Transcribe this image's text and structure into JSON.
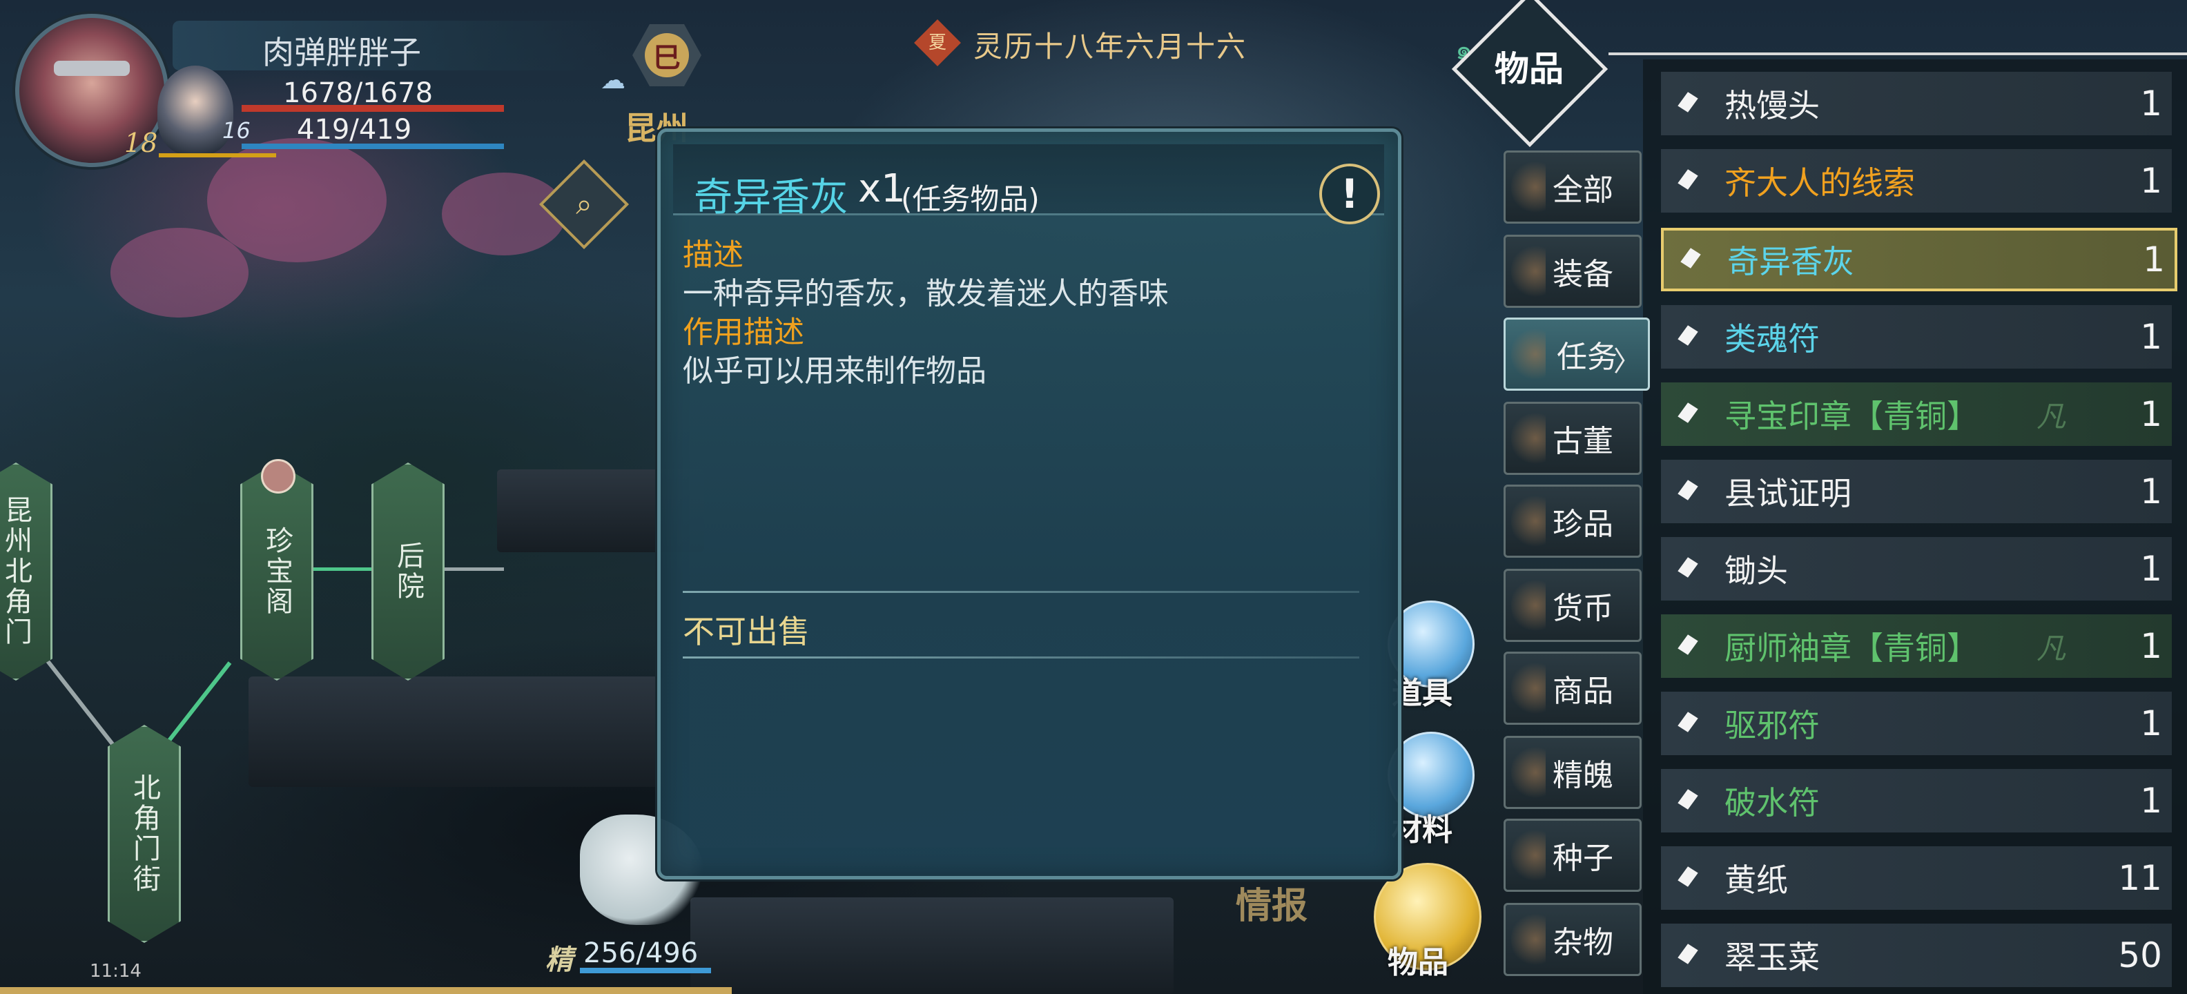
{
  "player": {
    "name": "肉弹胖胖子",
    "level": "18",
    "hp": "1678/1678",
    "mp": "419/419",
    "companion_level": "16"
  },
  "world": {
    "time_glyph": "巳",
    "location": "昆州",
    "season_glyph": "夏",
    "date": "灵历十八年六月十六"
  },
  "map": {
    "nodes": [
      "昆州北角门",
      "珍宝阁",
      "后院",
      "北角门街"
    ]
  },
  "status": {
    "clock": "11:14",
    "stamina_icon": "精",
    "stamina": "256/496"
  },
  "dialog": {
    "item_name": "奇异香灰",
    "item_qty": "x1",
    "item_type": "(任务物品)",
    "info_icon": "!",
    "desc_label": "描述",
    "desc_text": "一种奇异的香灰，散发着迷人的香味",
    "use_label": "作用描述",
    "use_text": "似乎可以用来制作物品",
    "sell_note": "不可出售"
  },
  "side_buttons": {
    "tools": "道具",
    "materials": "材料",
    "items": "物品",
    "info": "情报"
  },
  "inventory": {
    "title": "物品",
    "categories": [
      "全部",
      "装备",
      "任务",
      "古董",
      "珍品",
      "货币",
      "商品",
      "精魄",
      "种子",
      "杂物"
    ],
    "active_category": "任务",
    "items": [
      {
        "name": "热馒头",
        "count": "1",
        "color": "#f2f2f2"
      },
      {
        "name": "齐大人的线索",
        "count": "1",
        "color": "#f1a11f"
      },
      {
        "name": "奇异香灰",
        "count": "1",
        "color": "#5cd4ea"
      },
      {
        "name": "类魂符",
        "count": "1",
        "color": "#5cd4ea"
      },
      {
        "name": "寻宝印章【青铜】",
        "count": "1",
        "color": "#5fc26d",
        "rarity": "凡"
      },
      {
        "name": "县试证明",
        "count": "1",
        "color": "#f2f2f2"
      },
      {
        "name": "锄头",
        "count": "1",
        "color": "#f2f2f2"
      },
      {
        "name": "厨师袖章【青铜】",
        "count": "1",
        "color": "#5fc26d",
        "rarity": "凡"
      },
      {
        "name": "驱邪符",
        "count": "1",
        "color": "#5fc26d"
      },
      {
        "name": "破水符",
        "count": "1",
        "color": "#5fc26d"
      },
      {
        "name": "黄纸",
        "count": "11",
        "color": "#f2f2f2"
      },
      {
        "name": "翠玉菜",
        "count": "50",
        "color": "#f2f2f2"
      }
    ]
  }
}
